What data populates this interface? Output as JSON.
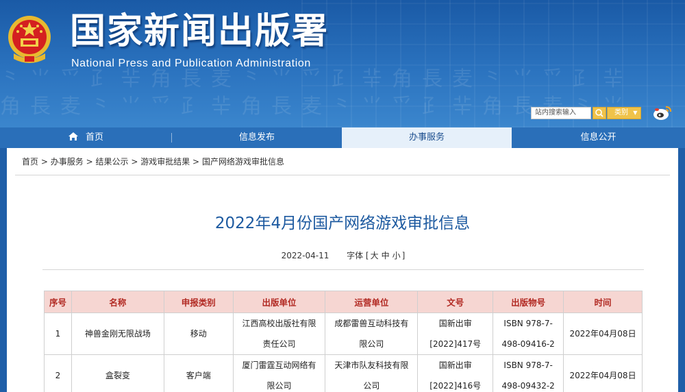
{
  "header": {
    "site_title": "国家新闻出版署",
    "site_subtitle": "National Press and Publication Administration",
    "search_placeholder": "站内搜索输入",
    "category_label": "类别"
  },
  "nav": {
    "items": [
      {
        "label": "首页",
        "icon": "home-icon"
      },
      {
        "label": "信息发布"
      },
      {
        "label": "办事服务",
        "active": true
      },
      {
        "label": "信息公开"
      }
    ]
  },
  "breadcrumb": {
    "items": [
      "首页",
      "办事服务",
      "结果公示",
      "游戏审批结果",
      "国产网络游戏审批信息"
    ],
    "separator": ">"
  },
  "article": {
    "title": "2022年4月份国产网络游戏审批信息",
    "date": "2022-04-11",
    "font_label": "字体",
    "font_sizes": [
      "大",
      "中",
      "小"
    ]
  },
  "table": {
    "headers": [
      "序号",
      "名称",
      "申报类别",
      "出版单位",
      "运营单位",
      "文号",
      "出版物号",
      "时间"
    ],
    "rows": [
      {
        "no": "1",
        "name": "神兽金刚无限战场",
        "category": "移动",
        "publisher_l1": "江西高校出版社有限",
        "publisher_l2": "责任公司",
        "operator_l1": "成都雷兽互动科技有",
        "operator_l2": "限公司",
        "doc_l1": "国新出审",
        "doc_l2": "[2022]417号",
        "isbn_l1": "ISBN 978-7-",
        "isbn_l2": "498-09416-2",
        "date": "2022年04月08日"
      },
      {
        "no": "2",
        "name": "盒裂变",
        "category": "客户端",
        "publisher_l1": "厦门雷霆互动网络有",
        "publisher_l2": "限公司",
        "operator_l1": "天津市队友科技有限",
        "operator_l2": "公司",
        "doc_l1": "国新出审",
        "doc_l2": "[2022]416号",
        "isbn_l1": "ISBN 978-7-",
        "isbn_l2": "498-09432-2",
        "date": "2022年04月08日"
      }
    ]
  },
  "colors": {
    "banner": "#1f5fa8",
    "nav_active_bg": "#e6f0fa",
    "title": "#1d5aa0",
    "table_header_bg": "#f6d6d2",
    "table_header_text": "#b22a23",
    "search_button": "#f0c34a"
  }
}
